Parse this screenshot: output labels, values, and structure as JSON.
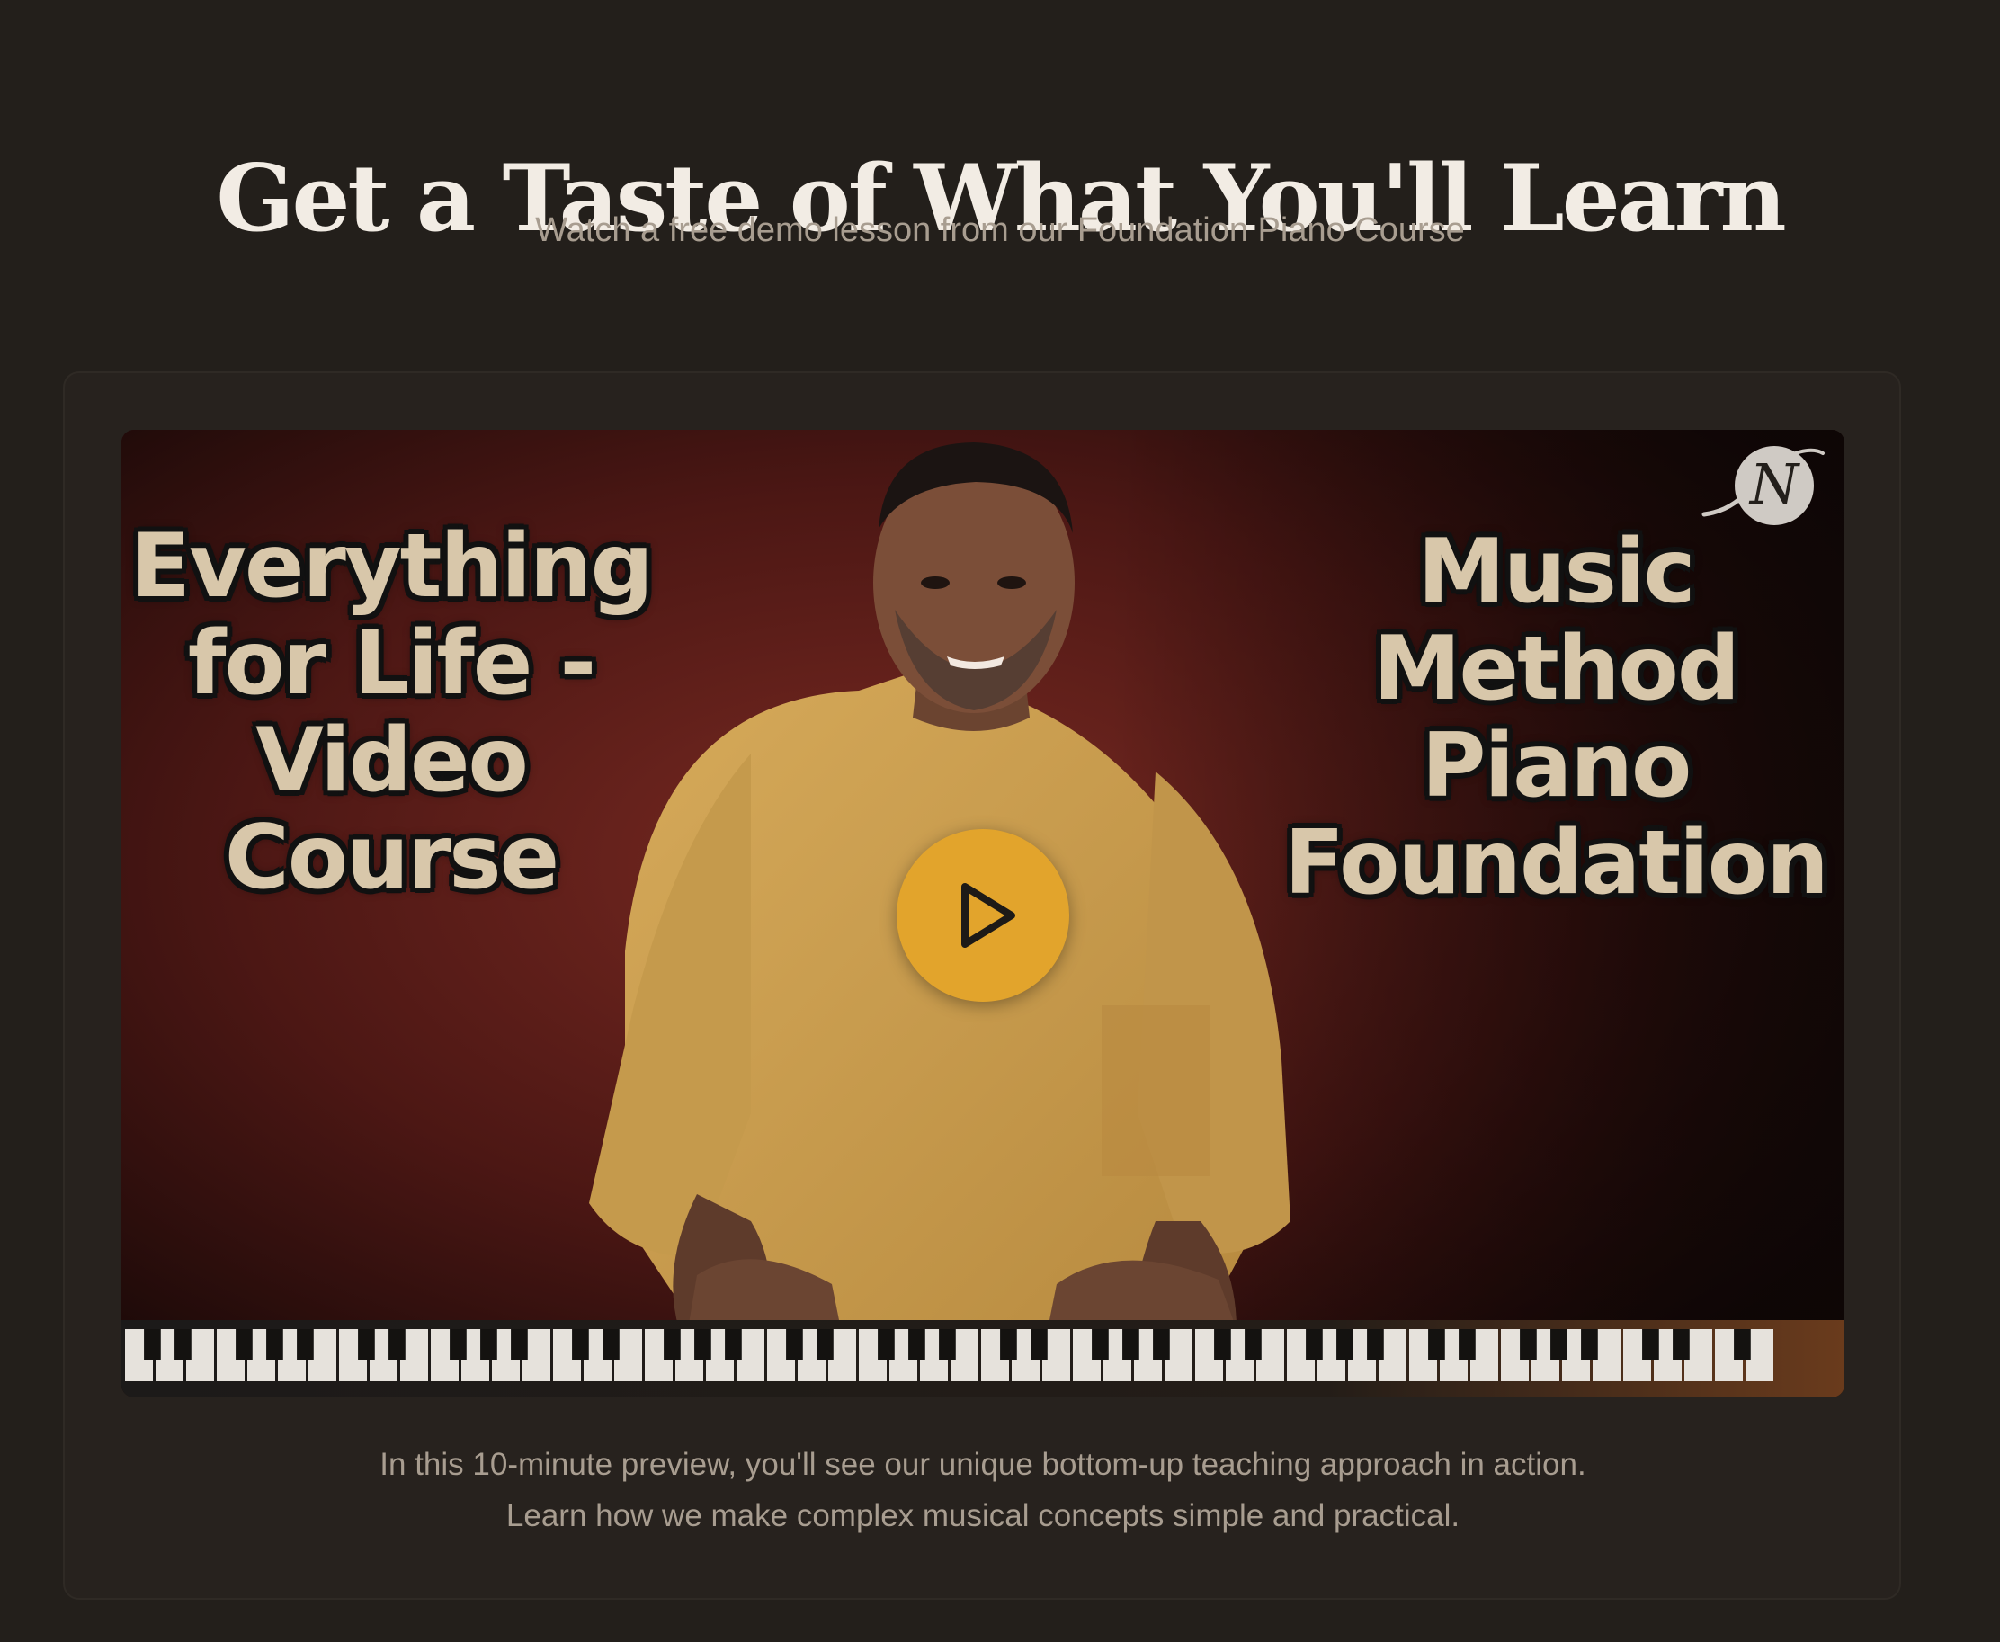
{
  "section": {
    "title": "Get a Taste of What You'll Learn",
    "subtitle": "Watch a free demo lesson from our Foundation Piano Course"
  },
  "video": {
    "thumbnail": {
      "left_text": [
        "Everything",
        "for Life -",
        "Video",
        "Course"
      ],
      "right_text": [
        "Music",
        "Method",
        "Piano",
        "Foundation"
      ],
      "logo_letter": "N"
    },
    "play_icon": "play-icon",
    "play_button_color": "#e2a42c"
  },
  "description": {
    "line1": "In this 10-minute preview, you'll see our unique bottom-up teaching approach in action.",
    "line2": "Learn how we make complex musical concepts simple and practical."
  },
  "colors": {
    "background": "#231f1b",
    "card": "#27221e",
    "title": "#f2ece4",
    "muted_text": "#a89d90",
    "accent": "#e2a42c"
  }
}
